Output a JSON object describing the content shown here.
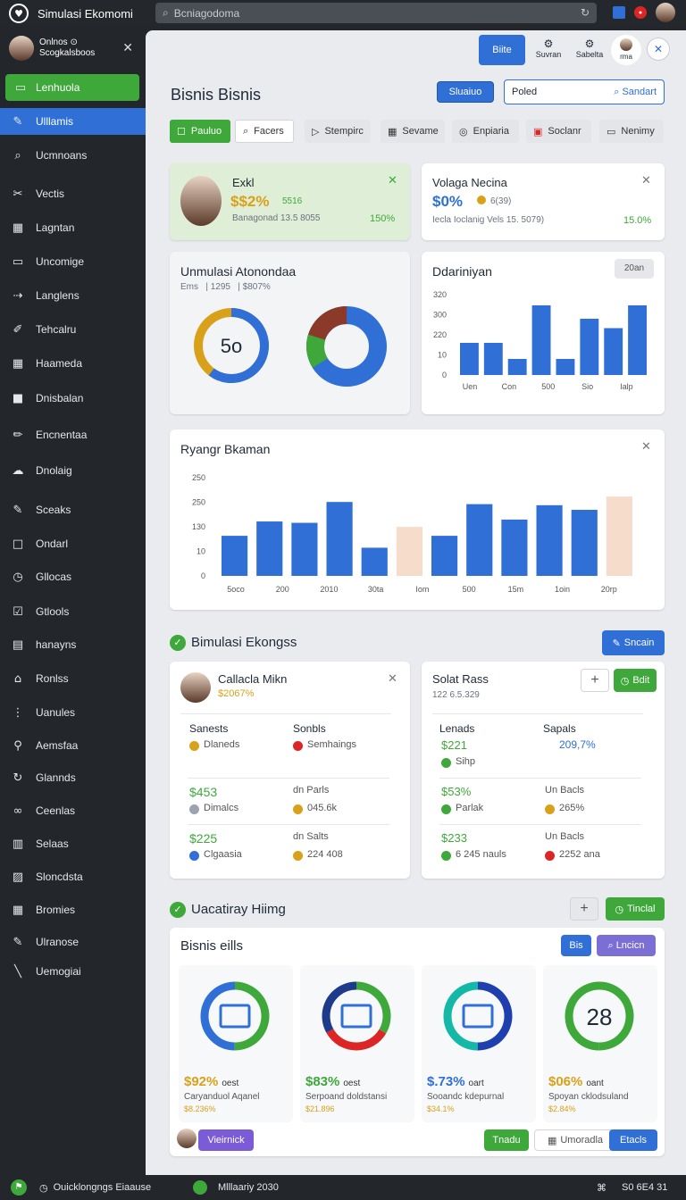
{
  "app": {
    "title": "Simulasi Ekomomi",
    "search_placeholder": "Bcniagodoma"
  },
  "sidebar": {
    "user_name": "Onlnos ⊙",
    "user_sub": "Scogkalsboos",
    "items": [
      {
        "label": "Lenhuola",
        "icon": "tag-icon"
      },
      {
        "label": "Ulllamis",
        "icon": "pen-icon"
      },
      {
        "label": "Ucmnoans",
        "icon": "search-icon"
      },
      {
        "label": "Vectis",
        "icon": "tools-icon"
      },
      {
        "label": "Lagntan",
        "icon": "grid-icon"
      },
      {
        "label": "Uncomige",
        "icon": "window-icon"
      },
      {
        "label": "Langlens",
        "icon": "share-icon"
      },
      {
        "label": "Tehcalru",
        "icon": "brush-icon"
      },
      {
        "label": "Haameda",
        "icon": "table-icon"
      },
      {
        "label": "Dnisbalan",
        "icon": "square-icon"
      },
      {
        "label": "Encnentaa",
        "icon": "pencil-icon"
      },
      {
        "label": "Dnolaig",
        "icon": "cloud-icon"
      },
      {
        "label": "Sceaks",
        "icon": "edit-icon"
      },
      {
        "label": "Ondarl",
        "icon": "box-icon"
      },
      {
        "label": "Gllocas",
        "icon": "clock-icon"
      },
      {
        "label": "Gtlools",
        "icon": "check-icon"
      },
      {
        "label": "hanayns",
        "icon": "file-icon"
      },
      {
        "label": "Ronlss",
        "icon": "home-icon"
      },
      {
        "label": "Uanules",
        "icon": "dots-icon"
      },
      {
        "label": "Aemsfaa",
        "icon": "link-icon"
      },
      {
        "label": "Glannds",
        "icon": "refresh-icon"
      },
      {
        "label": "Ceenlas",
        "icon": "chain-icon"
      },
      {
        "label": "Selaas",
        "icon": "book-icon"
      },
      {
        "label": "Sloncdsta",
        "icon": "image-icon"
      },
      {
        "label": "Bromies",
        "icon": "table-icon"
      },
      {
        "label": "Ulranose",
        "icon": "pen-icon"
      },
      {
        "label": "Uemogiai",
        "icon": "line-icon"
      }
    ]
  },
  "top_actions": {
    "btn1": "Biite",
    "btn2": "Suvran",
    "btn3": "Sabelta",
    "btn4": "rma"
  },
  "page": {
    "title": "Bisnis Bisnis",
    "btn_label": "Sluaiuo",
    "search_value": "Poled",
    "search_btn": "Sandart"
  },
  "tabs": [
    {
      "label": "Pauluo",
      "icon": "☐"
    },
    {
      "label": "Facers",
      "icon": "⌕"
    },
    {
      "label": "Stempirc",
      "icon": "▷"
    },
    {
      "label": "Sevame",
      "icon": "▦"
    },
    {
      "label": "Enpiaria",
      "icon": "◎"
    },
    {
      "label": "Soclanr",
      "icon": "▣"
    },
    {
      "label": "Nenimy",
      "icon": "▭"
    }
  ],
  "stat1": {
    "name": "Exkl",
    "value": "$$2%",
    "value_sub": "5516",
    "note": "Banagonad 13.5 8055",
    "pct": "150%"
  },
  "stat2": {
    "title": "Volaga Necina",
    "value": "$0%",
    "value_sub": "6(39)",
    "note": "Iecla Ioclanig  Vels 15. 5079)",
    "pct": "15.0%"
  },
  "donut_card": {
    "title": "Unmulasi Atonondaa",
    "sub1": "Ems",
    "sub2": "1295",
    "sub3": "$807%",
    "center": "5o"
  },
  "bar_card": {
    "title": "Ddariniyan",
    "badge": "20an",
    "chart_data": {
      "type": "bar",
      "categories": [
        "Uen",
        "Con",
        "500",
        "Sio",
        "Ialp"
      ],
      "yticks": [
        "320",
        "300",
        "220",
        "10",
        "0"
      ],
      "values": [
        120,
        120,
        60,
        260,
        60,
        210,
        175,
        260
      ],
      "ymax": 300
    }
  },
  "bar_card2": {
    "title": "Ryangr Bkaman",
    "chart_data": {
      "type": "bar",
      "categories": [
        "5oco",
        "200",
        "2010",
        "30ta",
        "Iom",
        "500",
        "15m",
        "1oin",
        "20rp"
      ],
      "yticks": [
        "250",
        "250",
        "130",
        "10",
        "0"
      ],
      "values": [
        185,
        210,
        245,
        300,
        130,
        185,
        185,
        290,
        260,
        285,
        305,
        325
      ],
      "ymax": 340
    }
  },
  "section1": {
    "title": "Bimulasi Ekongss",
    "btn": "Sncain"
  },
  "left_card": {
    "name": "Callacla Mikn",
    "value": "$2067%",
    "col1": "Sanests",
    "col2": "Sonbls",
    "rows": [
      {
        "a_val": "",
        "a_lbl": "Dlaneds",
        "b_val": "",
        "b_lbl": "Semhaings"
      },
      {
        "a_val": "$453",
        "a_lbl": "Dimalcs",
        "b_val": "dn Parls",
        "b_lbl": "045.6k"
      },
      {
        "a_val": "$225",
        "a_lbl": "Clgaasia",
        "b_val": "dn Salts",
        "b_lbl": "224 408"
      }
    ]
  },
  "right_card": {
    "name": "Solat Rass",
    "sub": "122 6.5.329",
    "btn": "Bdit",
    "col1": "Lenads",
    "col2": "Sapals",
    "rows": [
      {
        "a_val": "$221",
        "a_lbl": "Sihp",
        "b_val": "209,7%",
        "b_lbl": ""
      },
      {
        "a_val": "$53%",
        "a_lbl": "Parlak",
        "b_val": "Un Bacls",
        "b_lbl": "265%"
      },
      {
        "a_val": "$233",
        "a_lbl": "6 245 nauls",
        "b_val": "Un Bacls",
        "b_lbl": "2252 ana"
      }
    ]
  },
  "section2": {
    "title": "Uacatiray Hiimg",
    "btn": "Tinclal"
  },
  "bottom_card": {
    "title": "Bisnis eills",
    "btn1": "Bis",
    "btn2": "Lncicn",
    "tiles": [
      {
        "value": "$92%",
        "unit": "oest",
        "desc": "Caryanduol Aqanel",
        "sub": "$8.236%",
        "center": "",
        "color": "#d9a11a"
      },
      {
        "value": "$83%",
        "unit": "oest",
        "desc": "Serpoand doldstansi",
        "sub": "$21.896",
        "center": "",
        "color": "#3ea83a"
      },
      {
        "value": "$.73%",
        "unit": "oart",
        "desc": "Sooandc kdepurnal",
        "sub": "$34.1%",
        "center": "",
        "color": "#2f6fd6"
      },
      {
        "value": "$06%",
        "unit": "oant",
        "desc": "Spoyan cklodsuland",
        "sub": "$2.84%",
        "center": "28",
        "color": "#d9a11a"
      }
    ],
    "footer_btn1": "Vieirnick",
    "footer_btn2": "Tnadu",
    "footer_btn3": "Umoradla",
    "footer_btn4": "Etacls"
  },
  "statusbar": {
    "left": "Ouicklongngs Eiaause",
    "mid": "Mlllaariy 2030",
    "right": "S0 6E4 31"
  }
}
